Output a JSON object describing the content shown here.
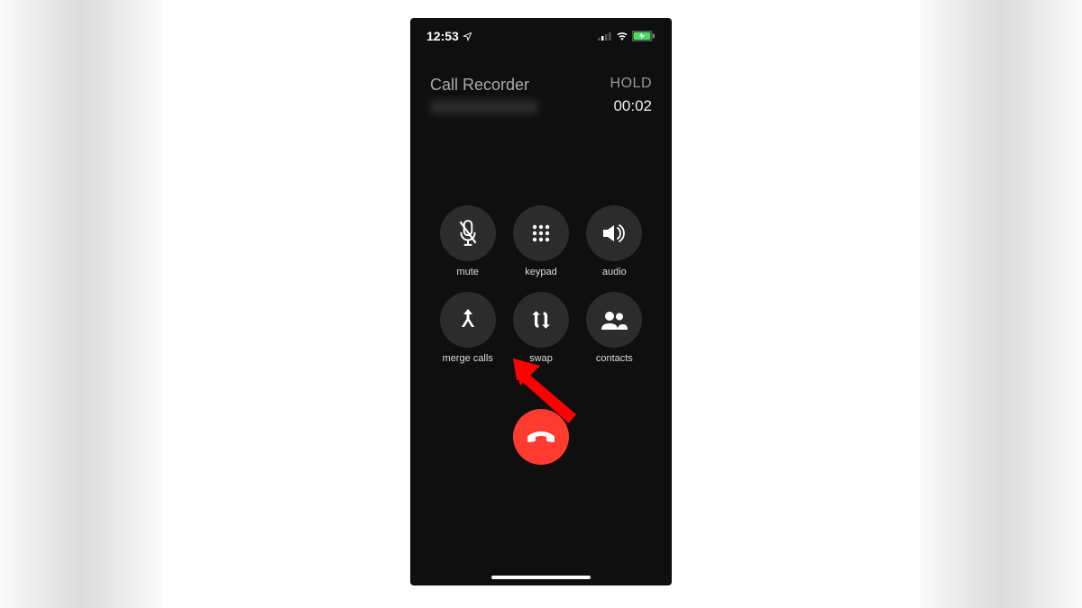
{
  "status_bar": {
    "time": "12:53",
    "battery_color": "#4cd964"
  },
  "call": {
    "caller_name": "Call Recorder",
    "hold_label": "HOLD",
    "duration": "00:02"
  },
  "buttons": {
    "mute": "mute",
    "keypad": "keypad",
    "audio": "audio",
    "merge": "merge calls",
    "swap": "swap",
    "contacts": "contacts"
  },
  "colors": {
    "end_call": "#ff3b30",
    "button_bg": "#2c2c2c",
    "phone_bg": "#0f0f0f"
  }
}
